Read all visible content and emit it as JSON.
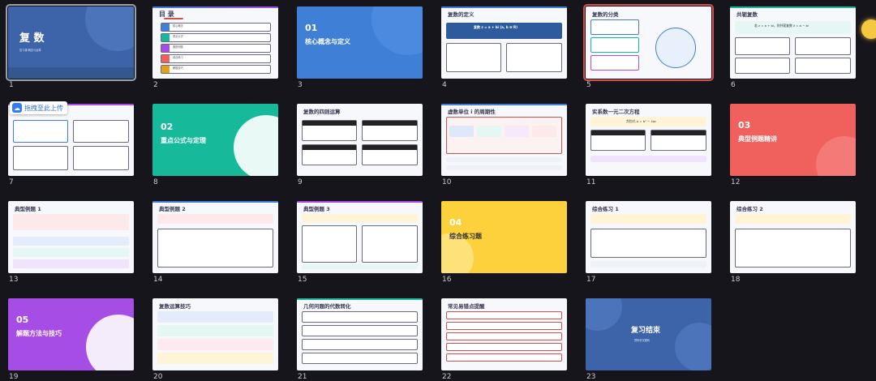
{
  "slides": [
    {
      "n": "1",
      "title": "复 数",
      "subtitle": "复习课·概念与运算",
      "kind": "cover"
    },
    {
      "n": "2",
      "title": "目 录",
      "items": [
        "核心概念",
        "重点公式",
        "典型例题",
        "综合练习",
        "解题技巧"
      ],
      "kind": "toc"
    },
    {
      "n": "3",
      "secnum": "01",
      "title": "核心概念与定义",
      "kind": "section-blue"
    },
    {
      "n": "4",
      "title": "复数的定义",
      "formula": "复数 z = a + bi (a, b ∈ R)",
      "kind": "content"
    },
    {
      "n": "5",
      "title": "复数的分类",
      "kind": "content"
    },
    {
      "n": "6",
      "title": "共轭复数",
      "formula": "若 z = a + bi，则共轭复数 z̄ = a − bi",
      "kind": "content"
    },
    {
      "n": "7",
      "title": "",
      "kind": "content"
    },
    {
      "n": "8",
      "secnum": "02",
      "title": "重点公式与定理",
      "kind": "section-green"
    },
    {
      "n": "9",
      "title": "复数的四则运算",
      "kind": "content"
    },
    {
      "n": "10",
      "title": "虚数单位 i 的周期性",
      "kind": "content"
    },
    {
      "n": "11",
      "title": "实系数一元二次方程",
      "formula": "判别式 Δ = b² − 4ac",
      "kind": "content"
    },
    {
      "n": "12",
      "secnum": "03",
      "title": "典型例题精讲",
      "kind": "section-red"
    },
    {
      "n": "13",
      "title": "典型例题 1",
      "kind": "content"
    },
    {
      "n": "14",
      "title": "典型例题 2",
      "kind": "content"
    },
    {
      "n": "15",
      "title": "典型例题 3",
      "kind": "content"
    },
    {
      "n": "16",
      "secnum": "04",
      "title": "综合练习题",
      "kind": "section-yellow"
    },
    {
      "n": "17",
      "title": "综合练习 1",
      "kind": "content"
    },
    {
      "n": "18",
      "title": "综合练习 2",
      "kind": "content"
    },
    {
      "n": "19",
      "secnum": "05",
      "title": "解题方法与技巧",
      "kind": "section-purple"
    },
    {
      "n": "20",
      "title": "复数运算技巧",
      "kind": "content"
    },
    {
      "n": "21",
      "title": "几何问题的代数转化",
      "kind": "content"
    },
    {
      "n": "22",
      "title": "常见易错点提醒",
      "kind": "content"
    },
    {
      "n": "23",
      "title": "复习结束",
      "subtitle": "预祝考试顺利",
      "kind": "end"
    }
  ],
  "upload": {
    "label": "拖拽至此上传"
  },
  "colors": {
    "background": "#16151b",
    "selected": "#d4504e",
    "accent_blue": "#3f7fd6",
    "accent_green": "#16b99a",
    "accent_red": "#f0605d",
    "accent_yellow": "#fdd13c",
    "accent_purple": "#a64de6"
  }
}
